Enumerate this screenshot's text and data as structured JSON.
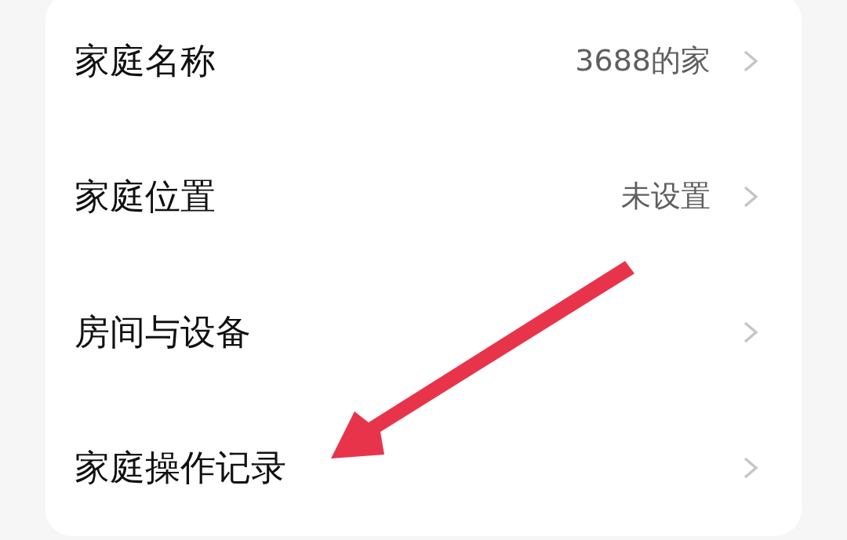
{
  "rows": [
    {
      "label": "家庭名称",
      "value": "3688的家"
    },
    {
      "label": "家庭位置",
      "value": "未设置"
    },
    {
      "label": "房间与设备"
    },
    {
      "label": "家庭操作记录"
    }
  ]
}
